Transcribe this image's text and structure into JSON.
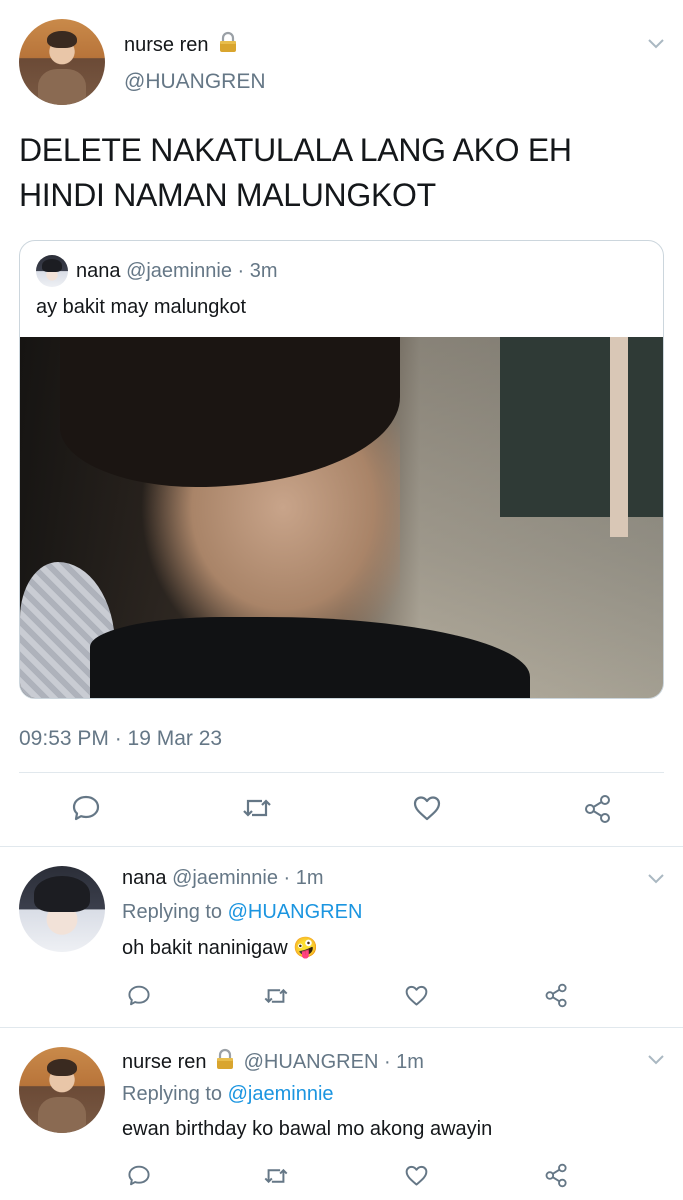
{
  "main_tweet": {
    "author_name": "nurse ren",
    "author_handle": "@HUANGREN",
    "text_line1": "DELETE NAKATULALA LANG AKO EH",
    "text_line2": "HINDI NAMAN MALUNGKOT",
    "timestamp": "09:53 PM · 19 Mar 23",
    "quote": {
      "author_name": "nana",
      "author_handle": "@jaeminnie",
      "time": "· 3m",
      "text": "ay bakit may malungkot"
    }
  },
  "replies": [
    {
      "author_name": "nana",
      "author_handle": "@jaeminnie",
      "time": "· 1m",
      "replying_prefix": "Replying to",
      "replying_to": "@HUANGREN",
      "text": "oh bakit naninigaw",
      "emoji": "🤪"
    },
    {
      "author_name": "nurse ren",
      "author_handle": "@HUANGREN",
      "time": "· 1m",
      "replying_prefix": "Replying to",
      "replying_to": "@jaeminnie",
      "text": "ewan birthday ko bawal mo akong awayin"
    }
  ],
  "icons": {
    "lock": "lock-icon",
    "reply": "reply-icon",
    "retweet": "retweet-icon",
    "like": "like-icon",
    "share": "share-icon",
    "more": "chevron-down-icon"
  },
  "colors": {
    "text": "#14171a",
    "muted": "#657786",
    "link": "#1b95e0",
    "border": "#e1e8ed"
  }
}
